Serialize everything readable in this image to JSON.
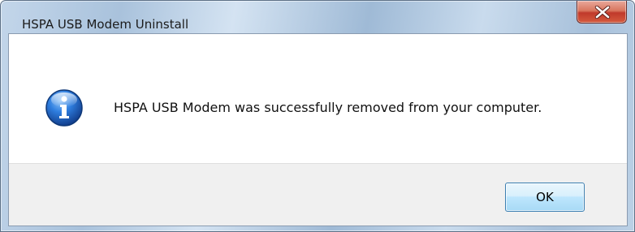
{
  "window": {
    "title": "HSPA USB Modem Uninstall"
  },
  "titlebar": {
    "close_icon": "close-x-icon"
  },
  "dialog": {
    "icon": "info-icon",
    "message": "HSPA USB Modem was successfully removed from your computer.",
    "ok_label": "OK"
  },
  "colors": {
    "close_button": "#c0392b",
    "info_icon_blue": "#1f5fb8",
    "ok_button_border": "#3c7fb1"
  }
}
